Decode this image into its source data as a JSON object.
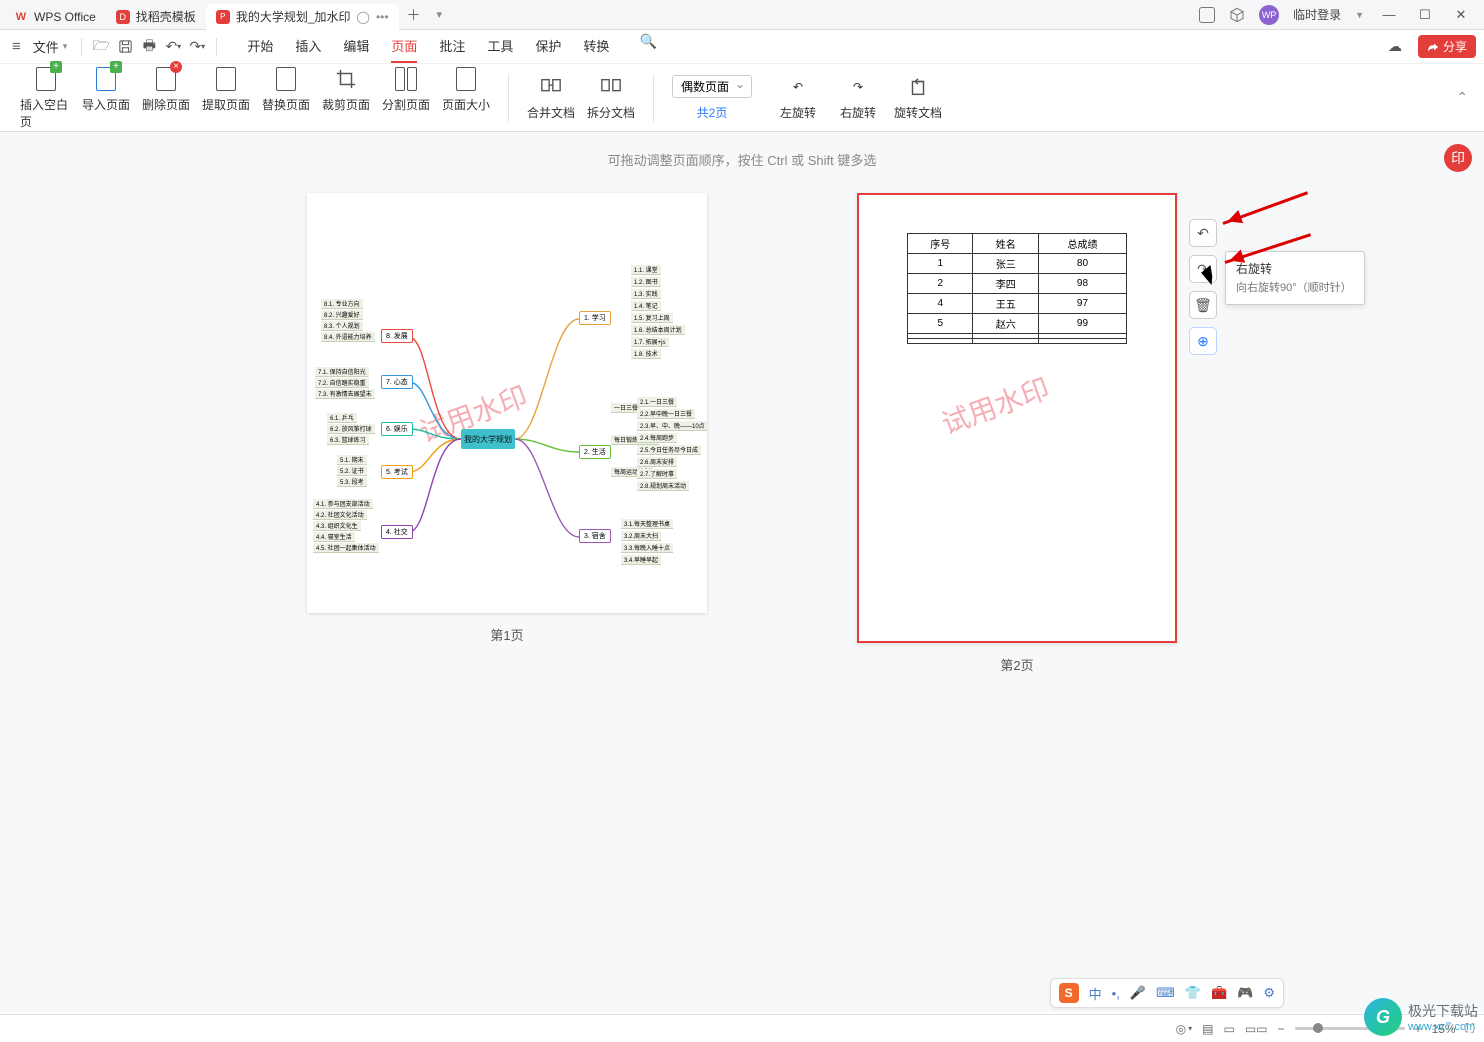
{
  "titlebar": {
    "app": "WPS Office",
    "tab_template": "找稻壳模板",
    "tab_doc": "我的大学规划_加水印",
    "login": "临时登录"
  },
  "quickbar": {
    "file": "文件"
  },
  "menu": {
    "start": "开始",
    "insert": "插入",
    "edit": "编辑",
    "page": "页面",
    "comment": "批注",
    "tools": "工具",
    "protect": "保护",
    "convert": "转换"
  },
  "ribbon": {
    "insert_blank": "插入空白页",
    "import_page": "导入页面",
    "delete_page": "删除页面",
    "extract_page": "提取页面",
    "replace_page": "替换页面",
    "crop_page": "裁剪页面",
    "split_page": "分割页面",
    "page_size": "页面大小",
    "merge_doc": "合并文档",
    "split_doc": "拆分文档",
    "page_select": "偶数页面",
    "page_count": "共2页",
    "rotate_left": "左旋转",
    "rotate_right": "右旋转",
    "rotate_doc": "旋转文档"
  },
  "share": "分享",
  "workspace": {
    "hint": "可拖动调整页面顺序，按住 Ctrl 或 Shift 键多选",
    "page1_label": "第1页",
    "page2_label": "第2页",
    "watermark": "试用水印"
  },
  "tooltip": {
    "title": "右旋转",
    "desc": "向右旋转90°（顺时针）"
  },
  "mindmap": {
    "center": "我的大学规划",
    "right": [
      {
        "label": "1. 学习",
        "leaves": [
          "1.1. 课堂",
          "1.2. 图书",
          "1.3. 实践",
          "1.4. 笔记",
          "1.5. 复习上周",
          "1.6. 总结本周计划",
          "1.7. 拓展+js",
          "1.8. 技术"
        ]
      },
      {
        "label": "2. 生活",
        "sub": [
          "一日三餐",
          "每日锻炼半小时",
          "每周运动计划"
        ],
        "leaves": [
          "2.1.一日三餐",
          "2.2.早中晚一日三餐",
          "2.3.早、中、晚——10点",
          "2.4.每周跑步",
          "2.5.今日任务尽今日成",
          "2.6.周末安排",
          "2.7.了解时事",
          "2.8.规划周末活动"
        ]
      },
      {
        "label": "3. 宿舍",
        "leaves": [
          "3.1.每天整理书桌",
          "3.2.周末大扫",
          "3.3.每晚入睡十点",
          "3.4.早睡早起"
        ]
      }
    ],
    "left": [
      {
        "label": "8. 发展",
        "leaves": [
          "8.1. 专业方向",
          "8.2. 兴趣爱好",
          "8.3. 个人规划",
          "8.4. 外语能力培养"
        ]
      },
      {
        "label": "7. 心态",
        "leaves": [
          "7.1. 保持自信阳光",
          "7.2. 自信踏实稳重",
          "7.3. 有激情去展望末"
        ]
      },
      {
        "label": "6. 娱乐",
        "leaves": [
          "6.1. 乒乓",
          "6.2. 放风筝打球",
          "6.3. 篮球练习"
        ]
      },
      {
        "label": "5. 考试",
        "leaves": [
          "5.1. 期末",
          "5.2. 证书",
          "5.3. 段考"
        ]
      },
      {
        "label": "4. 社交",
        "leaves": [
          "4.1. 参与团支部活动",
          "4.2. 社团文化活动",
          "4.3. 组织文化生",
          "4.4. 寝室生活",
          "4.5. 社团一起集体活动"
        ]
      }
    ]
  },
  "table": {
    "headers": [
      "序号",
      "姓名",
      "总成绩"
    ],
    "rows": [
      [
        "1",
        "张三",
        "80"
      ],
      [
        "2",
        "李四",
        "98"
      ],
      [
        "4",
        "王五",
        "97"
      ],
      [
        "5",
        "赵六",
        "99"
      ],
      [
        "",
        "",
        ""
      ],
      [
        "",
        "",
        ""
      ]
    ]
  },
  "ime": {
    "lang": "中"
  },
  "status": {
    "zoom": "15%"
  },
  "site": {
    "name": "极光下载站",
    "url": "www.xz7.com"
  }
}
